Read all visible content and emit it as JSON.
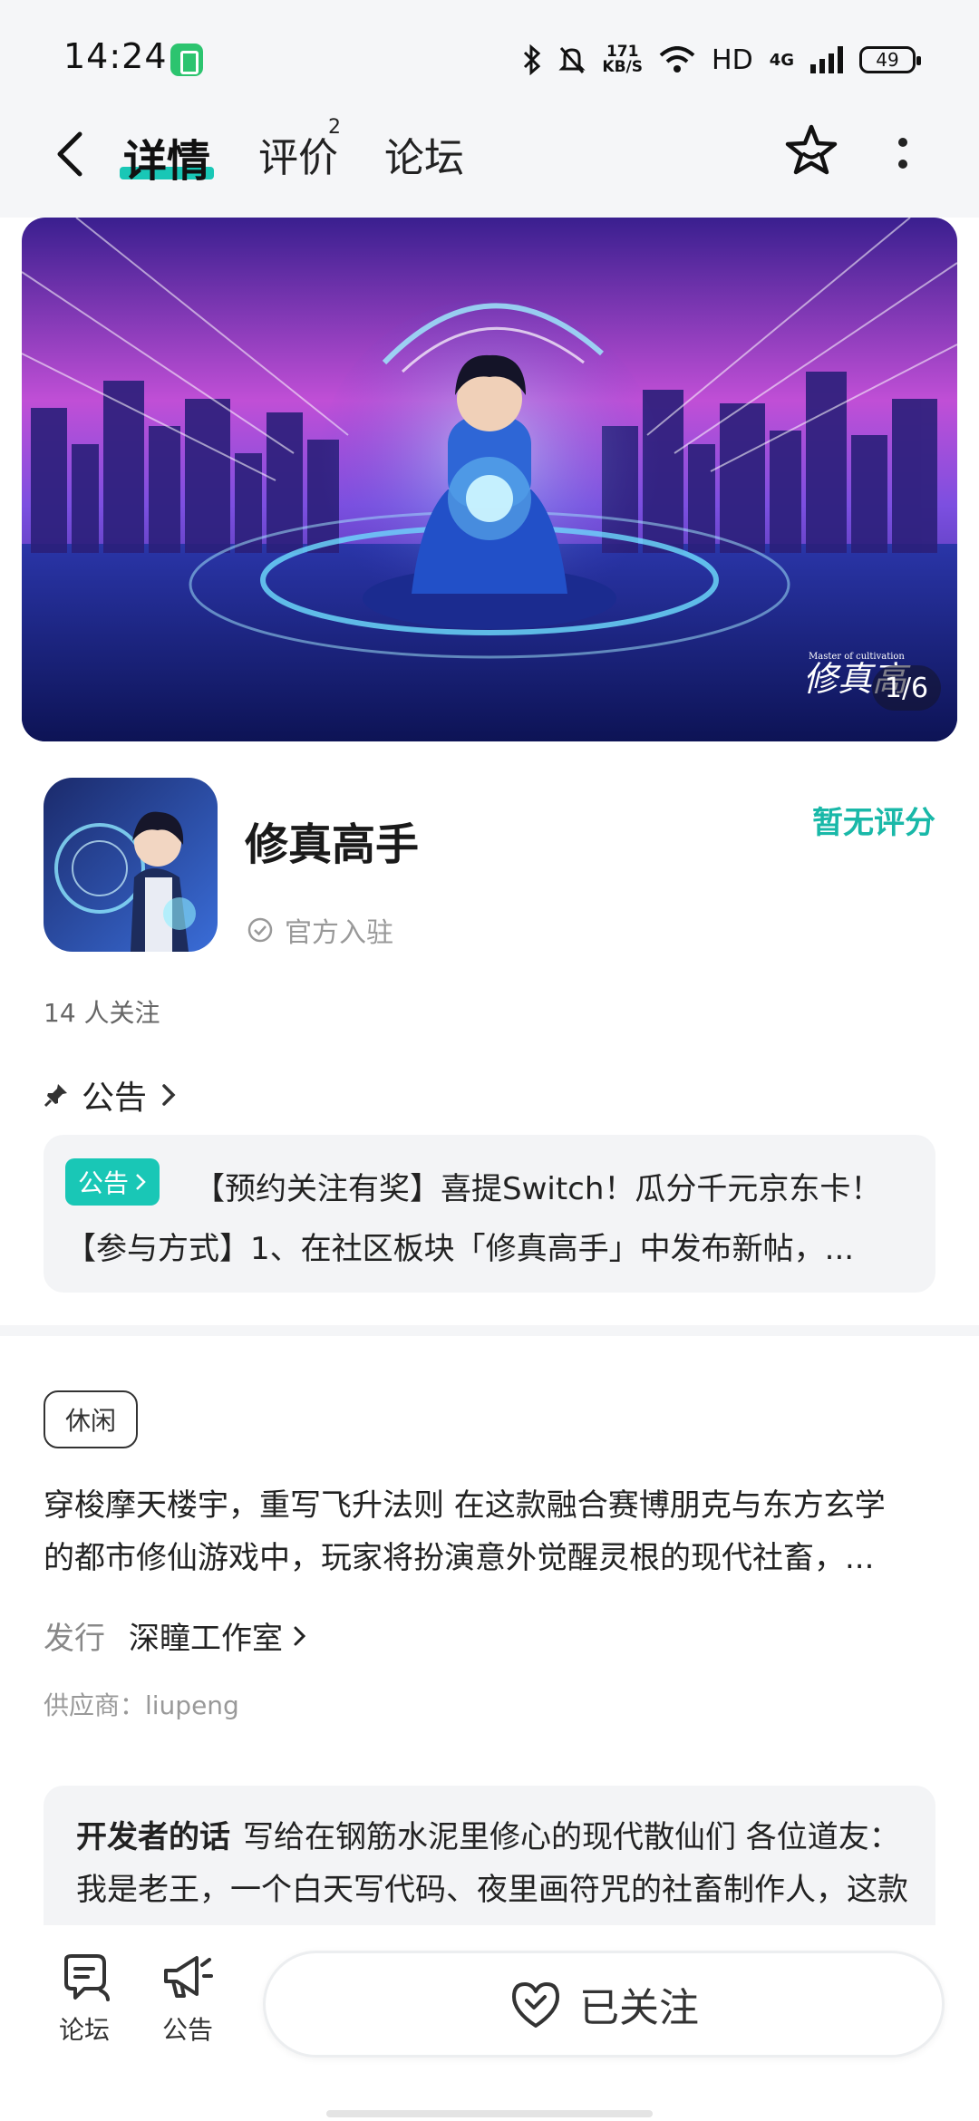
{
  "status_bar": {
    "time": "14:24",
    "network_speed_value": "171",
    "network_speed_unit": "KB/S",
    "hd_label": "HD",
    "network_type": "4G",
    "battery_level": "49"
  },
  "nav": {
    "tabs": [
      {
        "label": "详情",
        "active": true
      },
      {
        "label": "评价",
        "count": "2"
      },
      {
        "label": "论坛"
      }
    ],
    "accent_color": "#19c7b6"
  },
  "banner": {
    "counter": "1/6",
    "logo_caption": "Master of cultivation",
    "logo_text": "修真高"
  },
  "app": {
    "name": "修真高手",
    "verified_label": "官方入驻",
    "rating_text": "暂无评分",
    "followers": "14 人关注"
  },
  "notice": {
    "header": "公告",
    "badge": "公告",
    "line1": "【预约关注有奖】喜提Switch！瓜分千元京东卡！",
    "line2": "【参与方式】1、在社区板块「修真高手」中发布新帖，..."
  },
  "details": {
    "genre_tag": "休闲",
    "description_line1": "穿梭摩天楼宇，重写飞升法则 在这款融合赛博朋克与东方玄学",
    "description_line2": "的都市修仙游戏中，玩家将扮演意外觉醒灵根的现代社畜，...",
    "publisher_label": "发行",
    "publisher_name": "深瞳工作室",
    "supplier": "供应商：liupeng"
  },
  "developer_note": {
    "title": "开发者的话",
    "text": "写给在钢筋水泥里修心的现代散仙们 各位道友： 我是老王，一个白天写代码、夜里画符咒的社畜制作人，这款游戏的灵感来自我某天加班到凌晨时的一个念头。"
  },
  "bottom_bar": {
    "forum_label": "论坛",
    "notice_label": "公告",
    "follow_label": "已关注"
  }
}
